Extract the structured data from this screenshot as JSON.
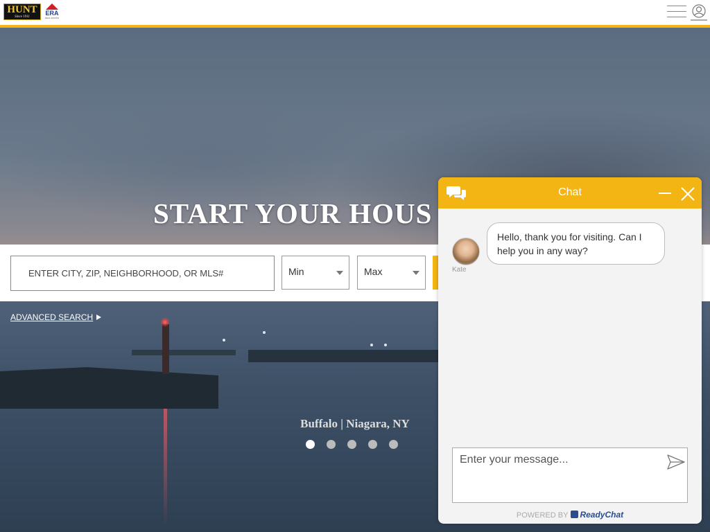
{
  "header": {
    "logo_hunt": "HUNT",
    "logo_hunt_sub": "Since 1911",
    "logo_era": "ERA",
    "logo_era_sub": "REAL ESTATE",
    "accent_color": "#f3b513"
  },
  "hero": {
    "title": "START YOUR HOUS",
    "caption": "Buffalo | Niagara, NY",
    "slides_count": 5,
    "active_slide": 1
  },
  "search": {
    "placeholder": "ENTER CITY, ZIP, NEIGHBORHOOD, OR MLS#",
    "min_label": "Min",
    "max_label": "Max",
    "advanced_label": "ADVANCED SEARCH"
  },
  "chat": {
    "title": "Chat",
    "agent_name": "Kate",
    "message": "Hello, thank you for visiting. Can I help you in any way?",
    "input_placeholder": "Enter your message...",
    "powered_by": "POWERED BY",
    "brand": "ReadyChat"
  }
}
